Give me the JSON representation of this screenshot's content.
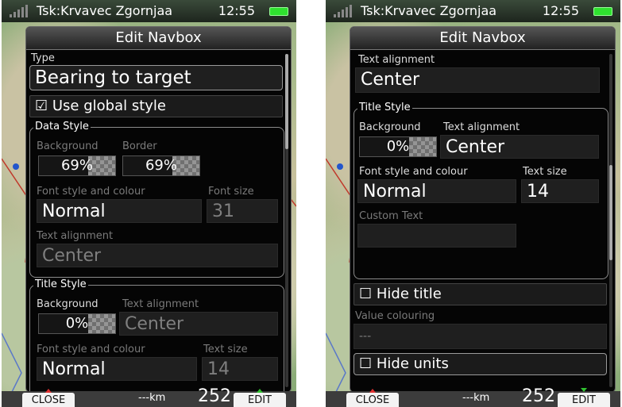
{
  "status": {
    "title": "Tsk:Krvavec Zgornjaa",
    "time": "12:55"
  },
  "dialog": {
    "title": "Edit Navbox"
  },
  "bottom": {
    "close": "CLOSE",
    "edit": "EDIT",
    "distance": "---km",
    "value": "252"
  },
  "left": {
    "type_label": "Type",
    "type_value": "Bearing to target",
    "use_global_style": "☑ Use global style",
    "data_style": {
      "legend": "Data Style",
      "background_label": "Background",
      "border_label": "Border",
      "background_value": "69%",
      "border_value": "69%",
      "font_label": "Font style and colour",
      "font_size_label": "Font size",
      "font_value": "Normal",
      "font_size_value": "31",
      "align_label": "Text alignment",
      "align_value": "Center"
    },
    "title_style": {
      "legend": "Title Style",
      "background_label": "Background",
      "align_label": "Text alignment",
      "background_value": "0%",
      "align_value": "Center",
      "font_label": "Font style and colour",
      "size_label": "Text size",
      "font_value": "Normal",
      "size_value": "14"
    }
  },
  "right": {
    "align_label": "Text alignment",
    "align_value": "Center",
    "title_style": {
      "legend": "Title Style",
      "background_label": "Background",
      "align_label": "Text alignment",
      "background_value": "0%",
      "align_value": "Center",
      "font_label": "Font style and colour",
      "size_label": "Text size",
      "font_value": "Normal",
      "size_value": "14",
      "custom_label": "Custom Text",
      "custom_value": ""
    },
    "hide_title": "☐ Hide title",
    "value_colouring_label": "Value colouring",
    "value_colouring_value": "---",
    "hide_units": "☐ Hide units"
  },
  "icons": [
    "signal-icon",
    "battery-icon",
    "checkbox-icon",
    "arrow-up-icon",
    "arrow-down-icon"
  ],
  "colors": {
    "battery": "#2fe12f",
    "close_marker": "#e03030",
    "edit_marker": "#2fc02f"
  }
}
